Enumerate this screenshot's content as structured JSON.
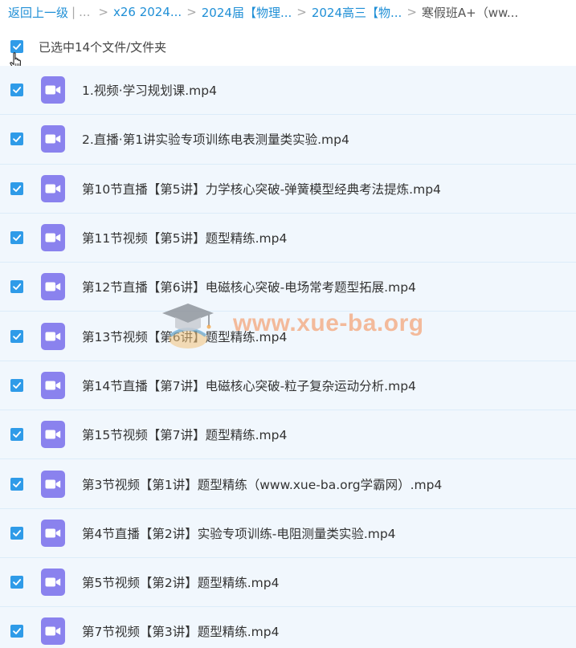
{
  "breadcrumb": {
    "back": "返回上一级",
    "divider": "|",
    "ellipsis": "...",
    "sep": ">",
    "items": [
      "x26 2024...",
      "2024届【物理...",
      "2024高三【物..."
    ],
    "current": "寒假班A+（ww..."
  },
  "selection": {
    "status": "已选中14个文件/文件夹",
    "all_checked": true
  },
  "files": [
    {
      "name": "1.视频·学习规划课.mp4",
      "checked": true,
      "icon": "video-icon"
    },
    {
      "name": "2.直播·第1讲实验专项训练电表测量类实验.mp4",
      "checked": true,
      "icon": "video-icon"
    },
    {
      "name": "第10节直播【第5讲】力学核心突破-弹簧模型经典考法提炼.mp4",
      "checked": true,
      "icon": "video-icon"
    },
    {
      "name": "第11节视频【第5讲】题型精练.mp4",
      "checked": true,
      "icon": "video-icon"
    },
    {
      "name": "第12节直播【第6讲】电磁核心突破-电场常考题型拓展.mp4",
      "checked": true,
      "icon": "video-icon"
    },
    {
      "name": "第13节视频【第6讲】题型精练.mp4",
      "checked": true,
      "icon": "video-icon"
    },
    {
      "name": "第14节直播【第7讲】电磁核心突破-粒子复杂运动分析.mp4",
      "checked": true,
      "icon": "video-icon"
    },
    {
      "name": "第15节视频【第7讲】题型精练.mp4",
      "checked": true,
      "icon": "video-icon"
    },
    {
      "name": "第3节视频【第1讲】题型精练（www.xue-ba.org学霸网）.mp4",
      "checked": true,
      "icon": "video-icon"
    },
    {
      "name": "第4节直播【第2讲】实验专项训练-电阻测量类实验.mp4",
      "checked": true,
      "icon": "video-icon"
    },
    {
      "name": "第5节视频【第2讲】题型精练.mp4",
      "checked": true,
      "icon": "video-icon"
    },
    {
      "name": "第7节视频【第3讲】题型精练.mp4",
      "checked": true,
      "icon": "video-icon"
    }
  ],
  "watermark": {
    "text": "www.xue-ba.org"
  },
  "colors": {
    "link": "#1f8fd6",
    "checkbox": "#2f9be8",
    "row_bg": "#f1f7fd",
    "video_icon": "#8a82ee",
    "watermark": "#f4b08a"
  }
}
